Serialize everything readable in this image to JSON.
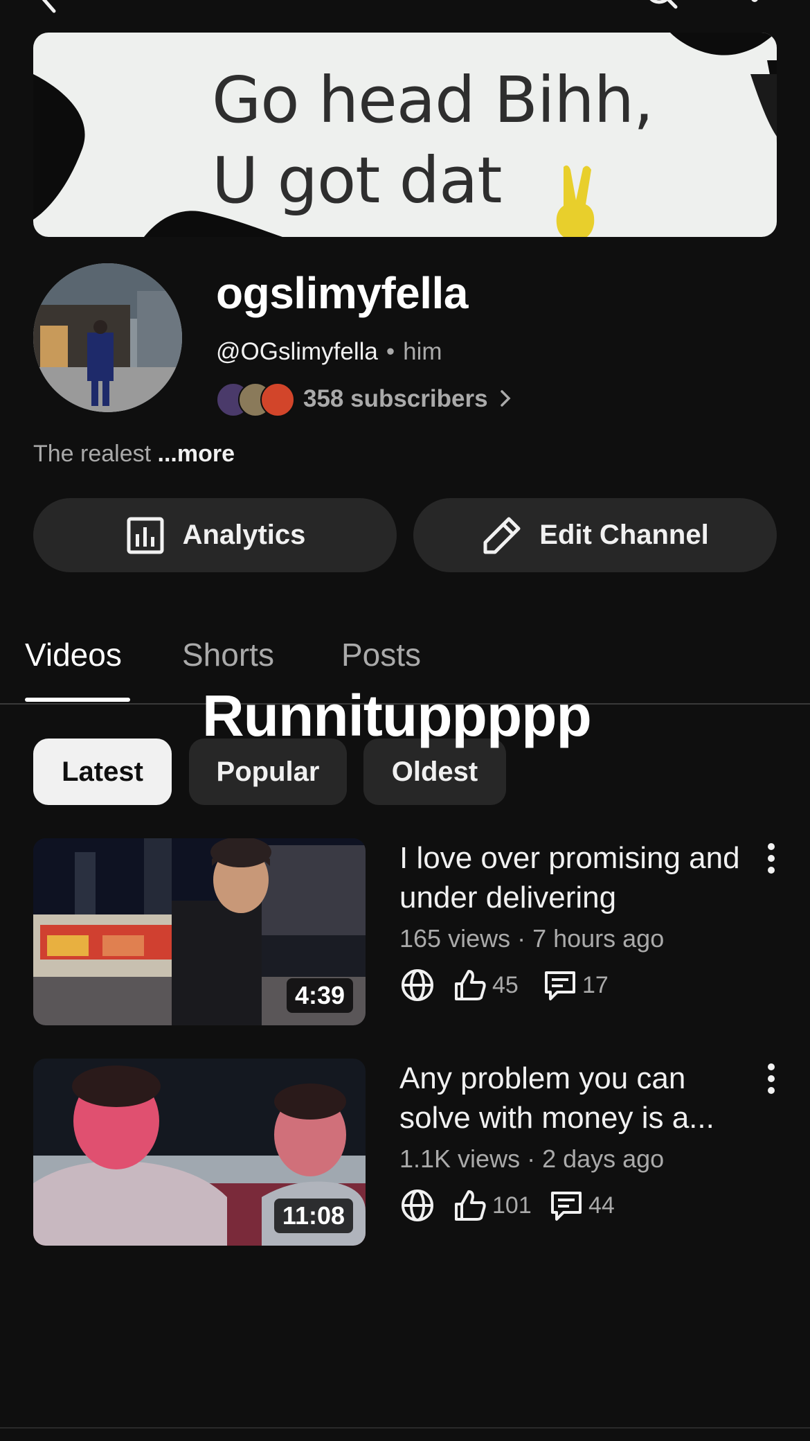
{
  "banner": {
    "line1": "Go head Bihh,",
    "line2": "U got dat"
  },
  "channel": {
    "name": "ogslimyfella",
    "handle": "@OGslimyfella",
    "separator": "•",
    "pronouns": "him",
    "subscribers": "358 subscribers",
    "description": "The realest ",
    "more_label": "...more"
  },
  "actions": {
    "analytics_label": "Analytics",
    "edit_label": "Edit Channel"
  },
  "tabs": [
    {
      "label": "Videos",
      "active": true
    },
    {
      "label": "Shorts",
      "active": false
    },
    {
      "label": "Posts",
      "active": false
    }
  ],
  "overlay_caption": "Runnituppppp",
  "chips": [
    {
      "label": "Latest",
      "selected": true
    },
    {
      "label": "Popular",
      "selected": false
    },
    {
      "label": "Oldest",
      "selected": false
    }
  ],
  "videos": [
    {
      "title": "I love over promising and under delivering",
      "meta": "165 views · 7 hours ago",
      "duration": "4:39",
      "likes": "45",
      "comments": "17"
    },
    {
      "title": "Any problem you can solve with money is a...",
      "meta": "1.1K views · 2 days ago",
      "duration": "11:08",
      "likes": "101",
      "comments": "44"
    }
  ],
  "icons": {
    "top_left": "back-arrow-icon",
    "top_right": [
      "search-icon",
      "more-vert-icon"
    ],
    "analytics": "analytics-icon",
    "edit": "pencil-icon",
    "visibility": "globe-icon",
    "likes": "thumbs-up-icon",
    "comments": "comment-icon"
  },
  "colors": {
    "background": "#0f0f0f",
    "surface": "#272727",
    "text_primary": "#f1f1f1",
    "text_secondary": "#aaaaaa",
    "chip_selected": "#f1f1f1"
  }
}
